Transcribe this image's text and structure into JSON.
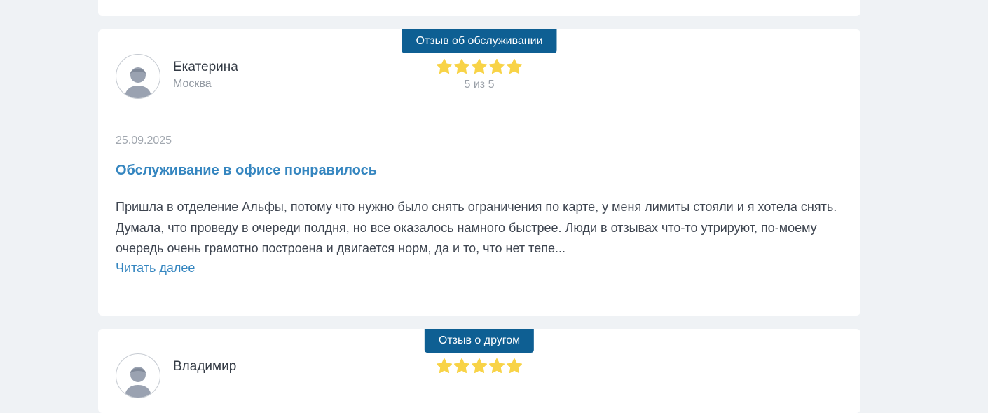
{
  "reviews": [
    {
      "category": "Отзыв об обслуживании",
      "author": "Екатерина",
      "city": "Москва",
      "rating": 5,
      "rating_text": "5 из 5",
      "date": "25.09.2025",
      "title": "Обслуживание в офисе понравилось",
      "text": "Пришла в отделение Альфы, потому что нужно было снять ограничения по карте, у меня лимиты стояли и я хотела снять. Думала, что проведу в очереди полдня, но все оказалось намного быстрее. Люди в отзывах что-то утрируют, по-моему очередь очень грамотно построена и двигается норм, да и то, что нет тепе...",
      "read_more": "Читать далее"
    },
    {
      "category": "Отзыв о другом",
      "author": "Владимир",
      "rating": 5
    }
  ],
  "icons": {
    "avatar": "user-avatar-icon",
    "star": "star-icon"
  },
  "colors": {
    "badge": "#0e5f93",
    "link": "#3586c0",
    "star": "#f8d347",
    "background": "#eff2f5"
  }
}
